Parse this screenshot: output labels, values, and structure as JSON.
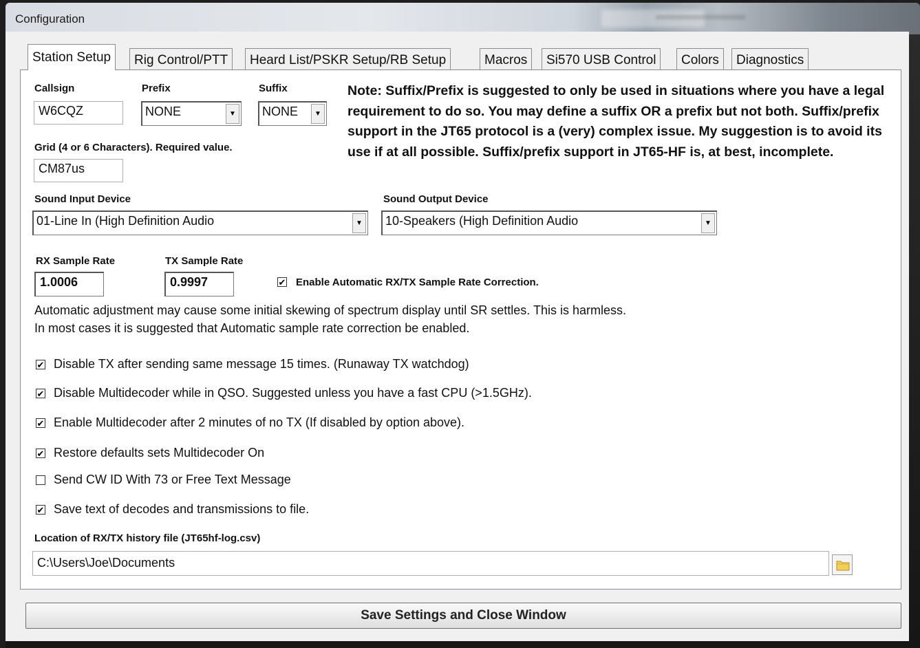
{
  "window": {
    "title": "Configuration"
  },
  "tabs": [
    {
      "label": "Station Setup"
    },
    {
      "label": "Rig Control/PTT"
    },
    {
      "label": "Heard List/PSKR Setup/RB Setup"
    },
    {
      "label": "Macros"
    },
    {
      "label": "Si570 USB Control"
    },
    {
      "label": "Colors"
    },
    {
      "label": "Diagnostics"
    }
  ],
  "station": {
    "callsign_label": "Callsign",
    "callsign_value": "W6CQZ",
    "prefix_label": "Prefix",
    "prefix_value": "NONE",
    "suffix_label": "Suffix",
    "suffix_value": "NONE",
    "grid_label": "Grid (4 or 6 Characters).  Required value.",
    "grid_value": "CM87us",
    "note": "Note:  Suffix/Prefix is suggested to only be used in situations where you have a legal requirement to do so.  You may define a suffix OR a prefix but not both.  Suffix/prefix support in the JT65 protocol is a (very) complex issue.  My suggestion is to avoid its use if at all possible.  Suffix/prefix support in JT65-HF is, at best, incomplete."
  },
  "sound": {
    "input_label": "Sound Input Device",
    "input_value": "01-Line In (High Definition Audio",
    "output_label": "Sound Output Device",
    "output_value": "10-Speakers (High Definition Audio"
  },
  "sample_rate": {
    "rx_label": "RX Sample Rate",
    "rx_value": "1.0006",
    "tx_label": "TX Sample Rate",
    "tx_value": "0.9997",
    "auto_label": "Enable Automatic RX/TX Sample Rate Correction.",
    "auto_checked": true,
    "info_line1": "Automatic adjustment may cause some initial skewing of spectrum display until SR settles.  This is harmless.",
    "info_line2": "In most cases it is suggested that Automatic sample rate correction be enabled."
  },
  "options": [
    {
      "label": "Disable TX after sending same message 15 times. (Runaway TX watchdog)",
      "checked": true
    },
    {
      "label": "Disable Multidecoder while in QSO.  Suggested unless you have a fast CPU (>1.5GHz).",
      "checked": true
    },
    {
      "label": "Enable Multidecoder after 2 minutes of no TX (If disabled by option above).",
      "checked": true
    },
    {
      "label": "Restore defaults sets Multidecoder On",
      "checked": true
    },
    {
      "label": "Send CW ID With 73 or Free Text Message",
      "checked": false
    },
    {
      "label": "Save text of decodes and transmissions to file.",
      "checked": true
    }
  ],
  "history": {
    "label": "Location of RX/TX history file (JT65hf-log.csv)",
    "path": "C:\\Users\\Joe\\Documents"
  },
  "save_button": "Save Settings and Close Window",
  "check_mark": "✔",
  "combo_arrow": "▼",
  "icons": {
    "folder": "folder-icon",
    "dropdown": "chevron-down-icon"
  }
}
